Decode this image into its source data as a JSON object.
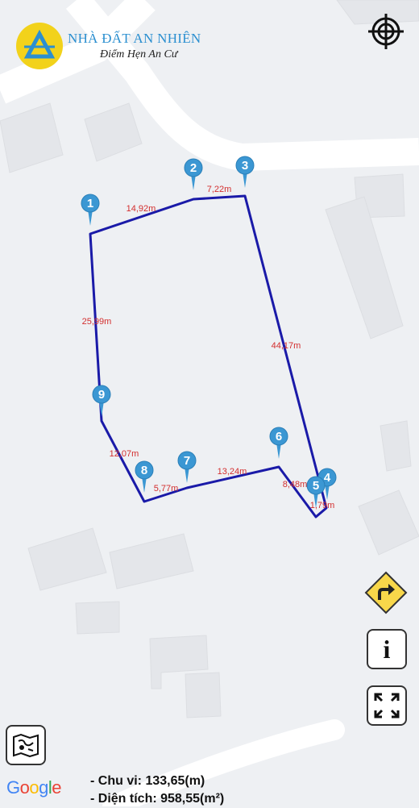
{
  "brand": {
    "title": "NHÀ ĐẤT AN NHIÊN",
    "subtitle": "Điểm Hẹn An Cư"
  },
  "colors": {
    "boundary": "#1a1aa8",
    "pin": "#3b97d3",
    "segment_label": "#d32f2f",
    "logo_yellow": "#f2d21b",
    "logo_blue": "#2b8fd0"
  },
  "pins": [
    {
      "label": "1"
    },
    {
      "label": "2"
    },
    {
      "label": "3"
    },
    {
      "label": "4"
    },
    {
      "label": "5"
    },
    {
      "label": "6"
    },
    {
      "label": "7"
    },
    {
      "label": "8"
    },
    {
      "label": "9"
    }
  ],
  "segments": [
    {
      "label": "14,92m"
    },
    {
      "label": "7,22m"
    },
    {
      "label": "44,17m"
    },
    {
      "label": "1,79m"
    },
    {
      "label": "8,48m"
    },
    {
      "label": "13,24m"
    },
    {
      "label": "5,77m"
    },
    {
      "label": "12,07m"
    },
    {
      "label": "25,99m"
    }
  ],
  "controls": {
    "locate_icon": "crosshair-icon",
    "directions_icon": "turn-right-sign-icon",
    "info_label": "i",
    "fullscreen_icon": "expand-icon",
    "map_type_icon": "map-layers-icon"
  },
  "attribution": {
    "google": [
      "G",
      "o",
      "o",
      "g",
      "l",
      "e"
    ],
    "google_colors": [
      "#4285f4",
      "#ea4335",
      "#fbbc05",
      "#4285f4",
      "#34a853",
      "#ea4335"
    ]
  },
  "summary": {
    "perimeter": "- Chu vi: 133,65(m)",
    "area": "- Diện tích: 958,55(m²)"
  }
}
